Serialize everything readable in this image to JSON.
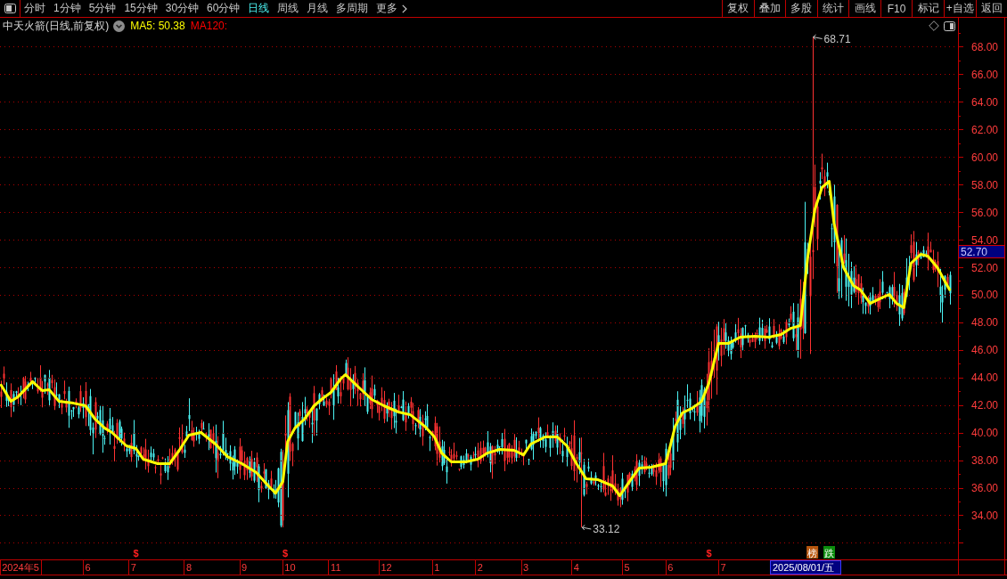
{
  "toolbar": {
    "periods": [
      {
        "label": "分时",
        "selected": false
      },
      {
        "label": "1分钟",
        "selected": false
      },
      {
        "label": "5分钟",
        "selected": false
      },
      {
        "label": "15分钟",
        "selected": false
      },
      {
        "label": "30分钟",
        "selected": false
      },
      {
        "label": "60分钟",
        "selected": false
      },
      {
        "label": "日线",
        "selected": true
      },
      {
        "label": "周线",
        "selected": false
      },
      {
        "label": "月线",
        "selected": false
      },
      {
        "label": "多周期",
        "selected": false
      }
    ],
    "more_menu": {
      "label": "更多"
    },
    "buttons": [
      "复权",
      "叠加",
      "多股",
      "统计",
      "画线",
      "F10",
      "标记",
      "+自选",
      "返回"
    ]
  },
  "info_bar": {
    "title": "中天火箭(日线,前复权)",
    "legend": [
      {
        "label": "MA5: 50.38",
        "color": "#ffff00"
      },
      {
        "label": "MA120:",
        "color": "#ff0000"
      }
    ]
  },
  "chart_data": {
    "type": "line",
    "grid": true,
    "categories": [
      null,
      null,
      null,
      null,
      null,
      null,
      null,
      null,
      "2024年5",
      null,
      null,
      null,
      null,
      null,
      null,
      null,
      null,
      null,
      null,
      null,
      null,
      null,
      null,
      null,
      null,
      null,
      null,
      null,
      null,
      null,
      null,
      null,
      null,
      null,
      null,
      null,
      "6",
      null,
      null,
      null,
      null,
      null,
      null,
      null,
      null,
      null,
      null,
      null,
      null,
      null,
      null,
      null,
      null,
      null,
      null,
      "7",
      null,
      null,
      null,
      null,
      null,
      null,
      null,
      null,
      null,
      null,
      null,
      null,
      null,
      null,
      null,
      null,
      null,
      null,
      null,
      null,
      null,
      null,
      "8",
      null,
      null,
      null,
      null,
      null,
      null,
      null,
      null,
      null,
      null,
      null,
      null,
      null,
      null,
      null,
      null,
      null,
      null,
      null,
      null,
      null,
      null,
      "9",
      null,
      null,
      null,
      null,
      null,
      null,
      null,
      null,
      null,
      null,
      null,
      null,
      null,
      null,
      null,
      null,
      null,
      null,
      "10",
      null,
      null,
      null,
      null,
      null,
      null,
      null,
      null,
      null,
      null,
      null,
      null,
      null,
      null,
      null,
      null,
      null,
      null,
      "11",
      null,
      null,
      null,
      null,
      null,
      null,
      null,
      null,
      null,
      null,
      null,
      null,
      null,
      null,
      null,
      null,
      null,
      null,
      null,
      null,
      "12",
      null,
      null,
      null,
      null,
      null,
      null,
      null,
      null,
      null,
      null,
      null,
      null,
      null,
      null,
      null,
      null,
      null,
      null,
      null,
      null,
      "1",
      null,
      null,
      null,
      null,
      null,
      null,
      null,
      null,
      null,
      null,
      null,
      null,
      null,
      null,
      null,
      null,
      null,
      "2",
      null,
      null,
      null,
      null,
      null,
      null,
      null,
      null,
      null,
      null,
      null,
      null,
      null,
      null,
      null,
      null,
      null,
      null,
      "3",
      null,
      null,
      null,
      null,
      null,
      null,
      null,
      null,
      null,
      null,
      null,
      null,
      null,
      null,
      null,
      null,
      null,
      null,
      null,
      null,
      "4",
      null,
      null,
      null,
      null,
      null,
      null,
      null,
      null,
      null,
      null,
      null,
      null,
      null,
      null,
      null,
      null,
      null,
      null,
      null,
      null,
      "5",
      null,
      null,
      null,
      null,
      null,
      null,
      null,
      null,
      null,
      null,
      null,
      null,
      null,
      null,
      null,
      null,
      null,
      "6",
      null,
      null,
      null,
      null,
      null,
      null,
      null,
      null,
      null,
      null,
      null,
      null,
      null,
      null,
      null,
      null,
      null,
      null,
      null,
      null,
      null,
      "7",
      null,
      null,
      null,
      null,
      null,
      null,
      null,
      null,
      null,
      null,
      null,
      null,
      null,
      null,
      null,
      null,
      null,
      null,
      null,
      null,
      null,
      null,
      null,
      null,
      null,
      null,
      null,
      null,
      null,
      null,
      null,
      null,
      null,
      null,
      null,
      null,
      null,
      null,
      null,
      null,
      null,
      null,
      null,
      null,
      null,
      null,
      null,
      null,
      null,
      null,
      null,
      null,
      null,
      null,
      null,
      null,
      null,
      null,
      null,
      null,
      null,
      null,
      null,
      null,
      null,
      null,
      null,
      null,
      null,
      null,
      null,
      null,
      null,
      null,
      null,
      null,
      null,
      null,
      null,
      null,
      null,
      null,
      null,
      null,
      null,
      null,
      null,
      null,
      null,
      null,
      null,
      null,
      null,
      null,
      null,
      null,
      null
    ],
    "values": [
      43.44,
      null,
      null,
      null,
      42.27,
      null,
      null,
      42.6,
      null,
      null,
      null,
      null,
      null,
      43.7,
      null,
      null,
      null,
      43.05,
      null,
      null,
      43.11,
      null,
      null,
      null,
      42.27,
      null,
      null,
      null,
      null,
      null,
      42.14,
      null,
      null,
      null,
      null,
      41.95,
      null,
      null,
      null,
      40.98,
      null,
      null,
      null,
      40.33,
      null,
      null,
      40.01,
      null,
      null,
      null,
      null,
      null,
      39.04,
      null,
      null,
      null,
      38.85,
      null,
      null,
      38.07,
      null,
      null,
      null,
      null,
      null,
      37.75,
      null,
      null,
      null,
      null,
      37.75,
      null,
      null,
      null,
      38.72,
      null,
      null,
      null,
      39.82,
      null,
      null,
      null,
      null,
      40.01,
      null,
      null,
      null,
      null,
      null,
      39.17,
      null,
      null,
      null,
      null,
      38.26,
      null,
      null,
      null,
      null,
      null,
      37.75,
      null,
      null,
      null,
      null,
      null,
      37.1,
      null,
      null,
      null,
      null,
      36.13,
      null,
      null,
      35.61,
      null,
      null,
      36.45,
      null,
      39.36,
      null,
      null,
      40.33,
      null,
      null,
      null,
      40.98,
      null,
      null,
      null,
      41.95,
      null,
      null,
      42.4,
      null,
      null,
      null,
      42.92,
      null,
      null,
      null,
      43.89,
      null,
      44.21,
      null,
      null,
      43.7,
      null,
      null,
      null,
      43.05,
      null,
      null,
      null,
      42.4,
      null,
      null,
      null,
      null,
      41.95,
      null,
      null,
      null,
      null,
      null,
      41.5,
      null,
      null,
      null,
      null,
      41.3,
      null,
      null,
      null,
      null,
      null,
      40.46,
      null,
      null,
      null,
      39.69,
      null,
      null,
      38.52,
      null,
      null,
      null,
      37.88,
      null,
      null,
      null,
      null,
      null,
      37.88,
      null,
      null,
      null,
      null,
      38.07,
      null,
      null,
      null,
      38.52,
      null,
      null,
      null,
      null,
      38.78,
      null,
      null,
      null,
      null,
      null,
      38.72,
      null,
      null,
      null,
      38.39,
      null,
      null,
      39.17,
      null,
      null,
      null,
      null,
      null,
      39.69,
      null,
      null,
      null,
      null,
      39.69,
      null,
      null,
      null,
      39.04,
      null,
      null,
      null,
      37.75,
      null,
      null,
      null,
      36.65,
      null,
      null,
      null,
      null,
      36.58,
      null,
      null,
      null,
      null,
      null,
      36.13,
      null,
      null,
      35.42,
      null,
      null,
      null,
      36.45,
      null,
      null,
      null,
      37.42,
      null,
      null,
      null,
      null,
      37.49,
      null,
      null,
      null,
      null,
      null,
      37.75,
      null,
      39.04,
      null,
      40.46,
      null,
      null,
      41.43,
      null,
      null,
      null,
      41.76,
      null,
      null,
      null,
      42.27,
      null,
      null,
      43.57,
      null,
      null,
      null,
      46.47,
      null,
      null,
      null,
      46.47,
      null,
      null,
      null,
      null,
      46.93,
      null,
      null,
      null,
      null,
      null,
      46.99,
      null,
      null,
      null,
      null,
      null,
      46.93,
      null,
      null,
      null,
      null,
      47.12,
      null,
      null,
      null,
      47.57,
      null,
      null,
      null,
      47.77,
      49.38,
      null,
      52.62,
      null,
      null,
      56.17,
      null,
      null,
      57.79,
      null,
      null,
      58.24,
      null,
      55.2,
      null,
      null,
      null,
      51.97,
      null,
      null,
      null,
      50.68,
      null,
      null,
      50.35,
      null,
      null,
      null,
      49.38,
      null,
      null,
      null,
      49.71,
      null,
      null,
      null,
      50.03,
      null,
      null,
      49.38,
      null,
      null,
      49.06,
      null,
      null,
      52.29,
      null,
      null,
      null,
      52.94,
      null,
      null,
      52.81,
      null,
      null,
      null,
      51.97,
      null,
      null,
      51.0,
      null,
      50.38,
      null,
      null,
      null
    ],
    "ylim": [
      30.8,
      70.1
    ],
    "yticks": [
      {
        "value": 34,
        "label": "34.00"
      },
      {
        "value": 36,
        "label": "36.00"
      },
      {
        "value": 38,
        "label": "38.00"
      },
      {
        "value": 40,
        "label": "40.00"
      },
      {
        "value": 42,
        "label": "42.00"
      },
      {
        "value": 44,
        "label": "44.00"
      },
      {
        "value": 46,
        "label": "46.00"
      },
      {
        "value": 48,
        "label": "48.00"
      },
      {
        "value": 50,
        "label": "50.00"
      },
      {
        "value": 52,
        "label": "52.00"
      },
      {
        "value": 54,
        "label": "54.00"
      },
      {
        "value": 56,
        "label": "56.00"
      },
      {
        "value": 58,
        "label": "58.00"
      },
      {
        "value": 60,
        "label": "60.00"
      },
      {
        "value": 62,
        "label": "62.00"
      },
      {
        "value": 64,
        "label": "64.00"
      },
      {
        "value": 66,
        "label": "66.00"
      },
      {
        "value": 68,
        "label": "68.00"
      }
    ],
    "annotations": [
      "68.71",
      "33.12"
    ]
  },
  "cursor": {
    "price": "52.70",
    "date": "2025/08/01/五"
  },
  "event_marks": [
    {
      "kind": "dollar",
      "label": "$"
    },
    {
      "kind": "dollar",
      "label": "$"
    },
    {
      "kind": "dollar",
      "label": "$"
    },
    {
      "kind": "badge",
      "label": "榜",
      "color": "#b8560e"
    },
    {
      "kind": "badge",
      "label": "跌",
      "color": "#0c8c0c"
    }
  ]
}
